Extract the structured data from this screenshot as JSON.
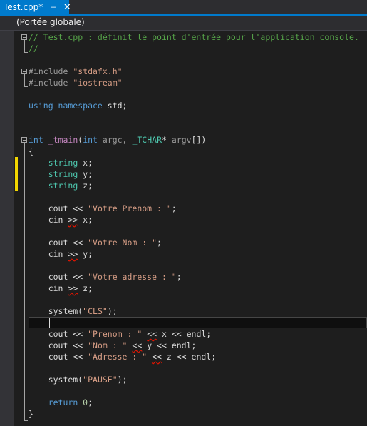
{
  "tab": {
    "title": "Test.cpp*",
    "pin_icon": "pin-icon",
    "close_icon": "close-icon",
    "color": "#007acc"
  },
  "navbar": {
    "scope": "(Portée globale)"
  },
  "editor": {
    "current_line": 26,
    "changed_lines": [
      12,
      14
    ],
    "lines": [
      [
        [
          "// Test.cpp : définit le point d'entrée pour l'application console.",
          "cmt"
        ]
      ],
      [
        [
          "//",
          "cmt"
        ]
      ],
      [],
      [
        [
          "#include ",
          "pp"
        ],
        [
          "\"stdafx.h\"",
          "str"
        ]
      ],
      [
        [
          "#include ",
          "pp"
        ],
        [
          "\"iostream\"",
          "str"
        ]
      ],
      [],
      [
        [
          "using namespace ",
          "kw"
        ],
        [
          "std;",
          "id"
        ]
      ],
      [],
      [],
      [
        [
          "int ",
          "kw"
        ],
        [
          "_tmain",
          "fn"
        ],
        [
          "(",
          "id"
        ],
        [
          "int ",
          "kw"
        ],
        [
          "argc",
          "par"
        ],
        [
          ", ",
          "id"
        ],
        [
          "_TCHAR",
          "ty"
        ],
        [
          "* ",
          "id"
        ],
        [
          "argv",
          "par"
        ],
        [
          "[])",
          "id"
        ]
      ],
      [
        [
          "{",
          "id"
        ]
      ],
      [
        [
          "    ",
          "id"
        ],
        [
          "string ",
          "ty"
        ],
        [
          "x;",
          "id"
        ]
      ],
      [
        [
          "    ",
          "id"
        ],
        [
          "string ",
          "ty"
        ],
        [
          "y;",
          "id"
        ]
      ],
      [
        [
          "    ",
          "id"
        ],
        [
          "string ",
          "ty"
        ],
        [
          "z;",
          "id"
        ]
      ],
      [],
      [
        [
          "    cout << ",
          "id"
        ],
        [
          "\"Votre Prenom : \"",
          "str"
        ],
        [
          ";",
          "id"
        ]
      ],
      [
        [
          "    cin ",
          "id"
        ],
        [
          ">>",
          "id sq"
        ],
        [
          " x;",
          "id"
        ]
      ],
      [],
      [
        [
          "    cout << ",
          "id"
        ],
        [
          "\"Votre Nom : \"",
          "str"
        ],
        [
          ";",
          "id"
        ]
      ],
      [
        [
          "    cin ",
          "id"
        ],
        [
          ">>",
          "id sq"
        ],
        [
          " y;",
          "id"
        ]
      ],
      [],
      [
        [
          "    cout << ",
          "id"
        ],
        [
          "\"Votre adresse : \"",
          "str"
        ],
        [
          ";",
          "id"
        ]
      ],
      [
        [
          "    cin ",
          "id"
        ],
        [
          ">>",
          "id sq"
        ],
        [
          " z;",
          "id"
        ]
      ],
      [],
      [
        [
          "    system(",
          "id"
        ],
        [
          "\"CLS\"",
          "str"
        ],
        [
          ");",
          "id"
        ]
      ],
      [],
      [
        [
          "    cout << ",
          "id"
        ],
        [
          "\"Prenom : \"",
          "str"
        ],
        [
          " ",
          "id"
        ],
        [
          "<<",
          "id sq"
        ],
        [
          " x << endl;",
          "id"
        ]
      ],
      [
        [
          "    cout << ",
          "id"
        ],
        [
          "\"Nom : \"",
          "str"
        ],
        [
          " ",
          "id"
        ],
        [
          "<<",
          "id sq"
        ],
        [
          " y << endl;",
          "id"
        ]
      ],
      [
        [
          "    cout << ",
          "id"
        ],
        [
          "\"Adresse : \"",
          "str"
        ],
        [
          " ",
          "id"
        ],
        [
          "<<",
          "id sq"
        ],
        [
          " z << endl;",
          "id"
        ]
      ],
      [],
      [
        [
          "    system(",
          "id"
        ],
        [
          "\"PAUSE\"",
          "str"
        ],
        [
          ");",
          "id"
        ]
      ],
      [],
      [
        [
          "    ",
          "id"
        ],
        [
          "return ",
          "kw"
        ],
        [
          "0",
          "num"
        ],
        [
          ";",
          "id"
        ]
      ],
      [
        [
          "}",
          "id"
        ]
      ]
    ]
  }
}
